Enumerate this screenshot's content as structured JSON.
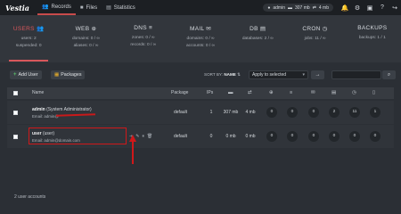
{
  "app": {
    "logo": "Vestia",
    "nav": [
      {
        "label": "Records",
        "icon": "users-icon"
      },
      {
        "label": "Files",
        "icon": "folder-icon"
      },
      {
        "label": "Statistics",
        "icon": "chart-icon"
      }
    ],
    "user_pill": {
      "name": "admin",
      "disk": "307 mb",
      "bandwidth": "4 mb"
    },
    "accent": "#d8575b"
  },
  "stats": [
    {
      "title": "USERS",
      "lines": [
        "users: 2",
        "suspended: 0"
      ]
    },
    {
      "title": "WEB",
      "lines": [
        "domains: 0 / ∞",
        "aliases: 0 / ∞"
      ]
    },
    {
      "title": "DNS",
      "lines": [
        "zones: 0 / ∞",
        "records: 0 / ∞"
      ]
    },
    {
      "title": "MAIL",
      "lines": [
        "domains: 0 / ∞",
        "accounts: 0 / ∞"
      ]
    },
    {
      "title": "DB",
      "lines": [
        "databases: 2 / ∞"
      ]
    },
    {
      "title": "CRON",
      "lines": [
        "jobs: 11 / ∞"
      ]
    },
    {
      "title": "BACKUPS",
      "lines": [
        "backups: 1 / 1"
      ]
    }
  ],
  "toolbar": {
    "add_user": "Add User",
    "packages": "Packages",
    "sort_by": "SORT BY:",
    "sort_field": "NAME",
    "bulk_select": "Apply to selected",
    "go": "→"
  },
  "table": {
    "headers": {
      "name": "Name",
      "package": "Package",
      "ips": "IPs"
    },
    "rows": [
      {
        "name": "admin",
        "role": "(System Administrator)",
        "email": "Email: admin@",
        "package": "default",
        "ips": "1",
        "disk": "307",
        "disk_unit": "mb",
        "bandwidth": "4",
        "bw_unit": "mb",
        "web": "0",
        "dns": "0",
        "mail": "0",
        "db": "2",
        "cron": "11",
        "backups": "1"
      },
      {
        "name": "user",
        "role": "(user)",
        "email": "Email: admin@domain.com",
        "package": "default",
        "ips": "0",
        "disk": "0",
        "disk_unit": "mb",
        "bandwidth": "0",
        "bw_unit": "mb",
        "web": "0",
        "dns": "0",
        "mail": "0",
        "db": "0",
        "cron": "0",
        "backups": "0"
      }
    ]
  },
  "footer": {
    "count": "2 user accounts"
  }
}
